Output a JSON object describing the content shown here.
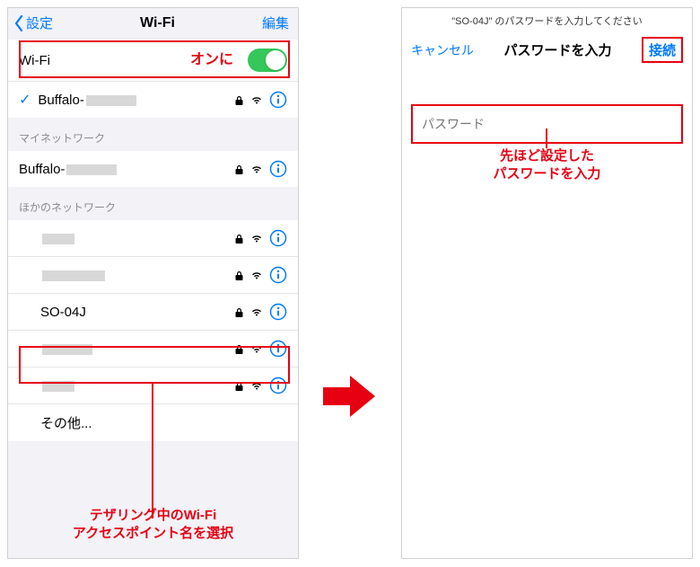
{
  "left": {
    "nav": {
      "back": "設定",
      "title": "Wi-Fi",
      "edit": "編集"
    },
    "wifi_toggle_label": "Wi-Fi",
    "connected": {
      "name_prefix": "Buffalo-"
    },
    "section_my": "マイネットワーク",
    "my_networks": [
      {
        "name_prefix": "Buffalo-"
      }
    ],
    "section_other": "ほかのネットワーク",
    "other_networks": [
      {
        "masked": true
      },
      {
        "masked": true
      },
      {
        "name": "SO-04J",
        "highlight": true
      },
      {
        "masked": true
      },
      {
        "masked": true
      }
    ],
    "other_label": "その他...",
    "annotations": {
      "on_label": "オンに",
      "bottom_line1": "テザリング中のWi-Fi",
      "bottom_line2": "アクセスポイント名を選択"
    }
  },
  "right": {
    "subtitle": "\"SO-04J\" のパスワードを入力してください",
    "cancel": "キャンセル",
    "title": "パスワードを入力",
    "connect": "接続",
    "password_placeholder": "パスワード",
    "annotation_line1": "先ほど設定した",
    "annotation_line2": "パスワードを入力"
  }
}
